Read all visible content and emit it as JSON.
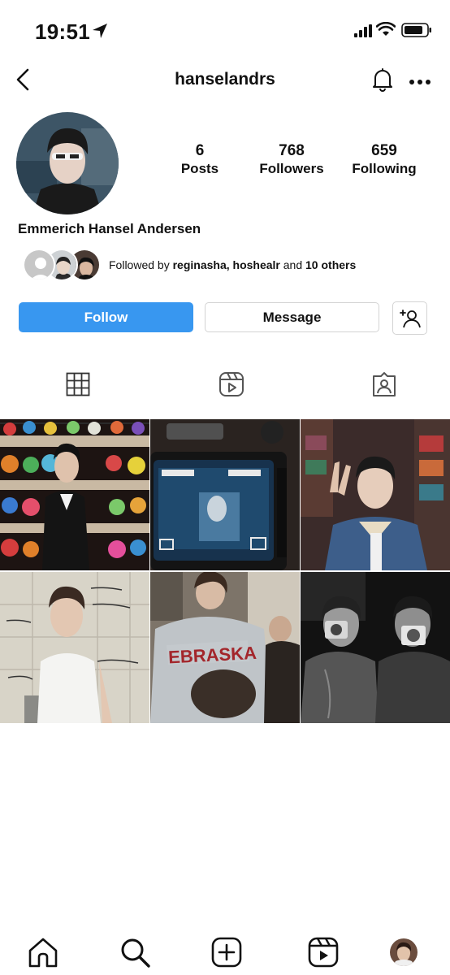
{
  "status_bar": {
    "time": "19:51"
  },
  "header": {
    "username": "hanselandrs"
  },
  "profile": {
    "full_name": "Emmerich Hansel Andersen",
    "stats": [
      {
        "value": "6",
        "label": "Posts"
      },
      {
        "value": "768",
        "label": "Followers"
      },
      {
        "value": "659",
        "label": "Following"
      }
    ],
    "followed_by": {
      "prefix": "Followed by",
      "names": "reginasha, hoshealr",
      "conjunction": "and",
      "others": "10 others"
    }
  },
  "actions": {
    "follow_label": "Follow",
    "message_label": "Message"
  },
  "tabs": [
    "grid-icon",
    "reels-icon",
    "tagged-icon"
  ],
  "colors": {
    "accent": "#3897f0"
  }
}
